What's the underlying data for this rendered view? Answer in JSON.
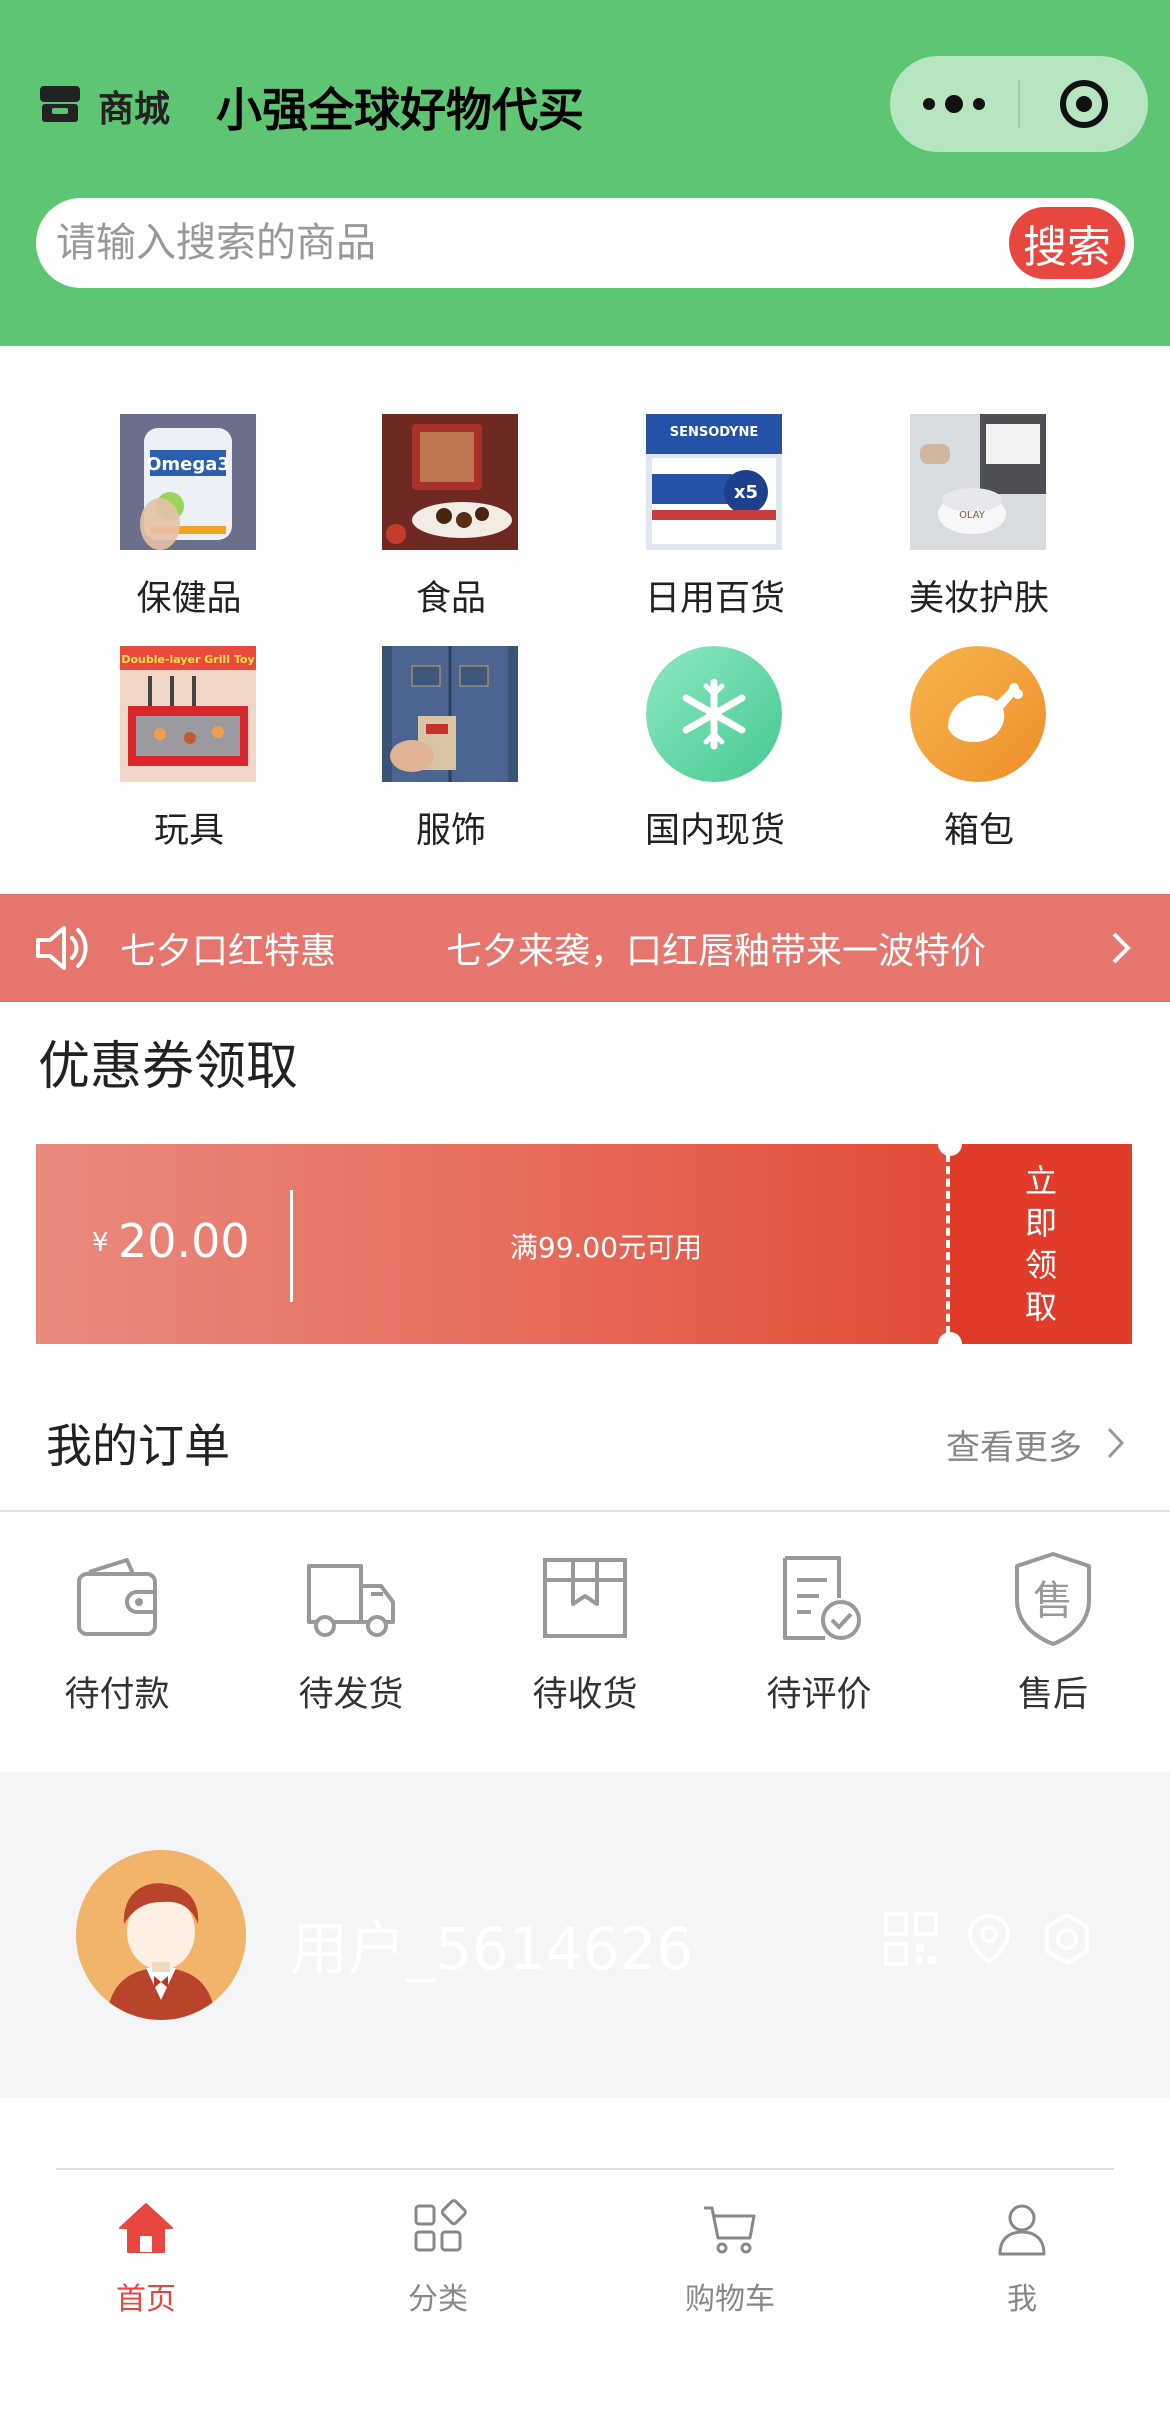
{
  "header": {
    "store_label": "商城",
    "shop_title": "小强全球好物代买",
    "bg_color": "#5ec572"
  },
  "search": {
    "placeholder": "请输入搜索的商品",
    "button_label": "搜索"
  },
  "categories": [
    {
      "label": "保健品",
      "icon": "supplement-bottle-image"
    },
    {
      "label": "食品",
      "icon": "chocolate-box-image"
    },
    {
      "label": "日用百货",
      "icon": "toothpaste-pack-image"
    },
    {
      "label": "美妆护肤",
      "icon": "skincare-jar-image"
    },
    {
      "label": "玩具",
      "icon": "toy-set-image"
    },
    {
      "label": "服饰",
      "icon": "denim-jacket-image"
    },
    {
      "label": "国内现货",
      "icon": "snowflake-icon"
    },
    {
      "label": "箱包",
      "icon": "chicken-icon"
    }
  ],
  "notice": {
    "tag": "七夕口红特惠",
    "text": "七夕来袭，口红唇釉带来一波特价"
  },
  "coupon_section": {
    "title": "优惠券领取",
    "currency": "¥",
    "amount": "20.00",
    "condition": "满99.00元可用",
    "claim": [
      "立",
      "即",
      "领",
      "取"
    ]
  },
  "orders": {
    "title": "我的订单",
    "more": "查看更多",
    "items": [
      {
        "label": "待付款",
        "icon": "wallet-icon"
      },
      {
        "label": "待发货",
        "icon": "truck-icon"
      },
      {
        "label": "待收货",
        "icon": "package-icon"
      },
      {
        "label": "待评价",
        "icon": "review-icon"
      },
      {
        "label": "售后",
        "icon": "after-sale-shield-icon"
      }
    ]
  },
  "profile": {
    "username": "用户_5614626"
  },
  "tabbar": [
    {
      "label": "首页",
      "icon": "home-icon",
      "active": true
    },
    {
      "label": "分类",
      "icon": "category-grid-icon",
      "active": false
    },
    {
      "label": "购物车",
      "icon": "cart-icon",
      "active": false
    },
    {
      "label": "我",
      "icon": "user-icon",
      "active": false
    }
  ],
  "colors": {
    "accent": "#e8473f",
    "notice_bg": "#e6756d",
    "coupon_start": "#e98a7e",
    "coupon_end": "#e24b37"
  }
}
